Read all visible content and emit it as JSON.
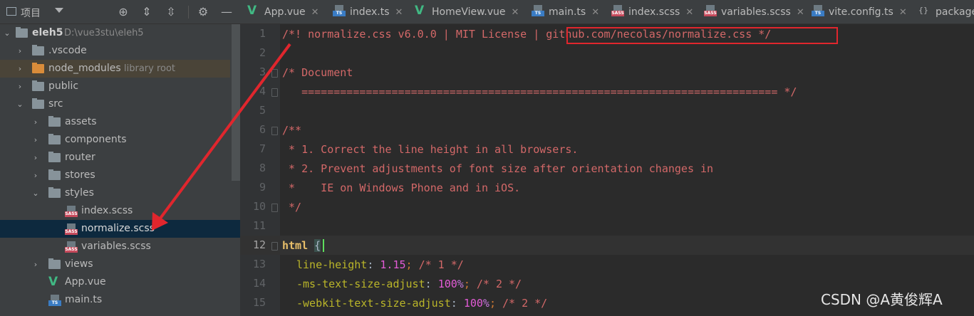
{
  "project_panel": {
    "title": "项目",
    "tree": [
      {
        "label": "eleh5",
        "path": "D:\\vue3stu\\eleh5",
        "type": "module"
      },
      {
        "label": ".vscode",
        "type": "folder"
      },
      {
        "label": "node_modules",
        "note": "library root",
        "type": "folder-lib"
      },
      {
        "label": "public",
        "type": "folder"
      },
      {
        "label": "src",
        "type": "folder"
      },
      {
        "label": "assets",
        "type": "folder"
      },
      {
        "label": "components",
        "type": "folder"
      },
      {
        "label": "router",
        "type": "folder"
      },
      {
        "label": "stores",
        "type": "folder"
      },
      {
        "label": "styles",
        "type": "folder"
      },
      {
        "label": "index.scss",
        "type": "sass"
      },
      {
        "label": "normalize.scss",
        "type": "sass"
      },
      {
        "label": "variables.scss",
        "type": "sass"
      },
      {
        "label": "views",
        "type": "folder"
      },
      {
        "label": "App.vue",
        "type": "vue"
      },
      {
        "label": "main.ts",
        "type": "ts"
      }
    ]
  },
  "tabs": [
    {
      "label": "App.vue",
      "icon": "vue-icon"
    },
    {
      "label": "index.ts",
      "icon": "ts-file-icon"
    },
    {
      "label": "HomeView.vue",
      "icon": "vue-icon"
    },
    {
      "label": "main.ts",
      "icon": "ts-file-icon"
    },
    {
      "label": "index.scss",
      "icon": "sass-file-icon"
    },
    {
      "label": "variables.scss",
      "icon": "sass-file-icon"
    },
    {
      "label": "vite.config.ts",
      "icon": "ts-file-icon"
    },
    {
      "label": "package",
      "icon": "json-file-icon"
    }
  ],
  "code": {
    "line_numbers": [
      "1",
      "2",
      "3",
      "4",
      "5",
      "6",
      "7",
      "8",
      "9",
      "10",
      "11",
      "12",
      "13",
      "14",
      "15"
    ],
    "lines": {
      "l1": "/*! normalize.css v6.0.0 | MIT License | github.com/necolas/normalize.css */",
      "l3": "/* Document",
      "l4": "   ========================================================================== */",
      "l6": "/**",
      "l7": " * 1. Correct the line height in all browsers.",
      "l8": " * 2. Prevent adjustments of font size after orientation changes in",
      "l9": " *    IE on Windows Phone and in iOS.",
      "l10": " */",
      "l12_sel": "html",
      "l12_brace": "{",
      "l13_prop": "line-height",
      "l13_val": "1.15",
      "l13_cm": "/* 1 */",
      "l14_prop": "-ms-text-size-adjust",
      "l14_val": "100",
      "l14_cm": "/* 2 */",
      "l15_prop": "-webkit-text-size-adjust",
      "l15_val": "100",
      "l15_cm": "/* 2 */"
    }
  },
  "watermark": "CSDN @A黄俊辉A",
  "colors": {
    "annotation": "#e0262d",
    "selected_row": "#0d293e"
  }
}
